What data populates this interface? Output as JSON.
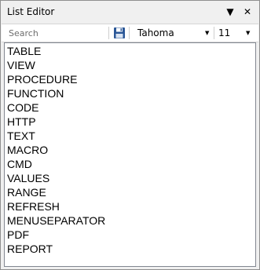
{
  "window": {
    "title": "List Editor"
  },
  "toolbar": {
    "search_placeholder": "Search",
    "font_value": "Tahoma",
    "size_value": "11"
  },
  "icons": {
    "menu": "dropdown-triangle",
    "close": "close-x",
    "save": "floppy-disk"
  },
  "list": {
    "items": [
      "TABLE",
      "VIEW",
      "PROCEDURE",
      "FUNCTION",
      "CODE",
      "HTTP",
      "TEXT",
      "MACRO",
      "CMD",
      "VALUES",
      "RANGE",
      "REFRESH",
      "MENUSEPARATOR",
      "PDF",
      "REPORT"
    ]
  }
}
